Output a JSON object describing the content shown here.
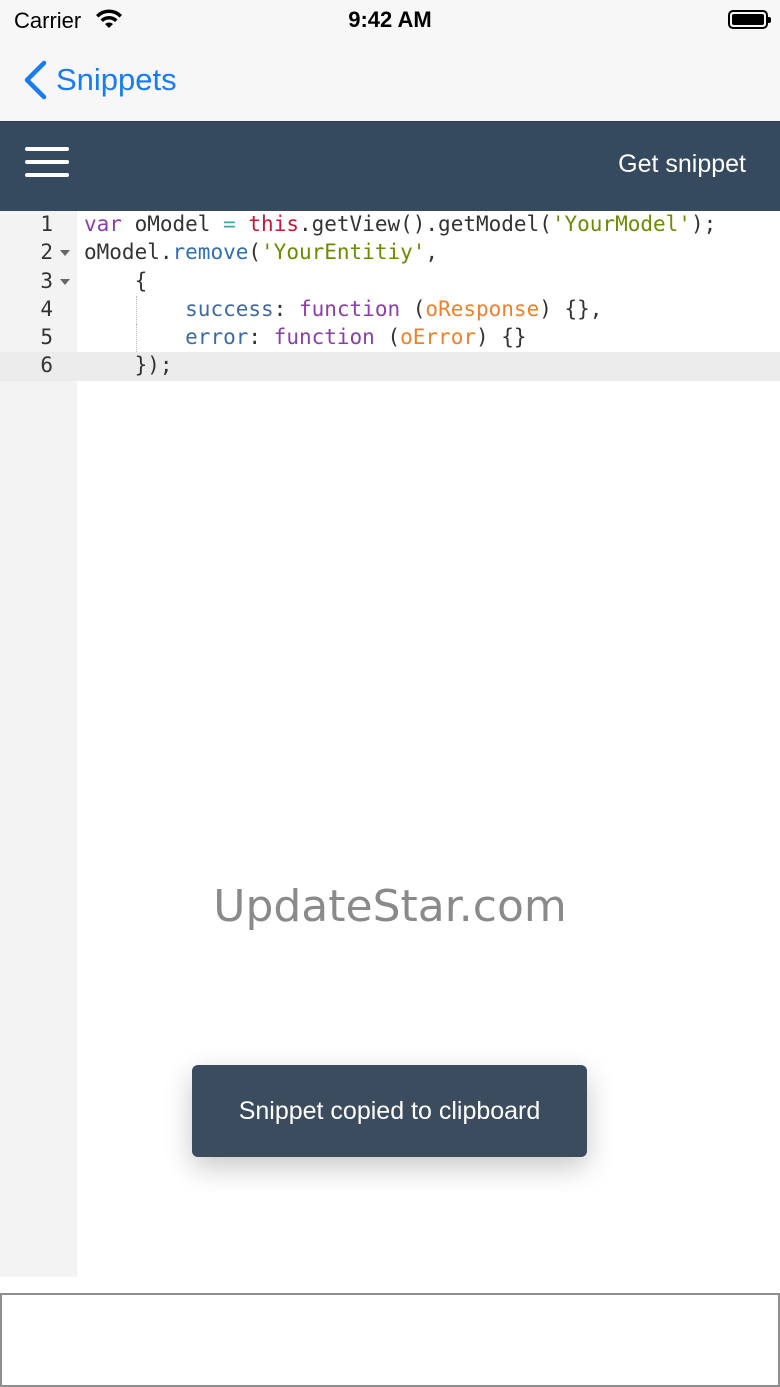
{
  "status_bar": {
    "carrier": "Carrier",
    "time": "9:42 AM"
  },
  "nav": {
    "back_label": "Snippets",
    "accent_color": "#1a7cf4"
  },
  "toolbar": {
    "menu_icon": "hamburger-menu-icon",
    "action_label": "Get snippet",
    "background_color": "#354a5f"
  },
  "editor": {
    "active_line": 6,
    "lines": [
      {
        "num": "1",
        "foldable": false,
        "tokens": [
          {
            "t": "var",
            "c": "k-kw"
          },
          {
            "t": " oModel ",
            "c": ""
          },
          {
            "t": "=",
            "c": "k-op"
          },
          {
            "t": " ",
            "c": ""
          },
          {
            "t": "this",
            "c": "k-this"
          },
          {
            "t": ".getView().getModel(",
            "c": ""
          },
          {
            "t": "'YourModel'",
            "c": "k-str"
          },
          {
            "t": ");",
            "c": ""
          }
        ]
      },
      {
        "num": "2",
        "foldable": true,
        "tokens": [
          {
            "t": "oModel.",
            "c": ""
          },
          {
            "t": "remove",
            "c": "k-fn"
          },
          {
            "t": "(",
            "c": ""
          },
          {
            "t": "'YourEntitiy'",
            "c": "k-str"
          },
          {
            "t": ",",
            "c": ""
          }
        ]
      },
      {
        "num": "3",
        "foldable": true,
        "tokens": [
          {
            "t": "    {",
            "c": ""
          }
        ]
      },
      {
        "num": "4",
        "foldable": false,
        "tokens": [
          {
            "t": "        ",
            "c": ""
          },
          {
            "t": "success",
            "c": "k-prop"
          },
          {
            "t": ": ",
            "c": ""
          },
          {
            "t": "function",
            "c": "k-kw"
          },
          {
            "t": " (",
            "c": ""
          },
          {
            "t": "oResponse",
            "c": "k-param"
          },
          {
            "t": ") {},",
            "c": ""
          }
        ]
      },
      {
        "num": "5",
        "foldable": false,
        "tokens": [
          {
            "t": "        ",
            "c": ""
          },
          {
            "t": "error",
            "c": "k-prop"
          },
          {
            "t": ": ",
            "c": ""
          },
          {
            "t": "function",
            "c": "k-kw"
          },
          {
            "t": " (",
            "c": ""
          },
          {
            "t": "oError",
            "c": "k-param"
          },
          {
            "t": ") {}",
            "c": ""
          }
        ]
      },
      {
        "num": "6",
        "foldable": false,
        "tokens": [
          {
            "t": "    });",
            "c": ""
          }
        ]
      }
    ]
  },
  "watermark": "UpdateStar.com",
  "toast": {
    "message": "Snippet copied to clipboard"
  }
}
